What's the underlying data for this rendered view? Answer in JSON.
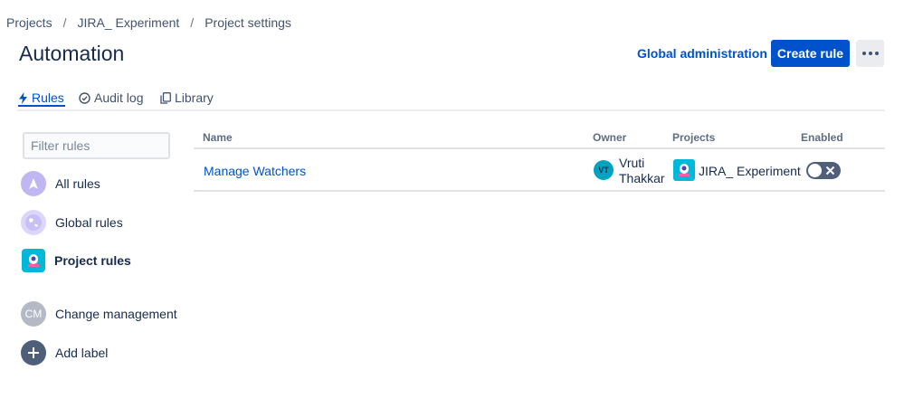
{
  "breadcrumb": {
    "items": [
      "Projects",
      "JIRA_ Experiment",
      "Project settings"
    ],
    "separator": "/"
  },
  "page": {
    "title": "Automation"
  },
  "header": {
    "global_admin_label": "Global administration",
    "create_rule_label": "Create rule"
  },
  "tabs": [
    {
      "label": "Rules",
      "icon": "lightning-icon",
      "active": true
    },
    {
      "label": "Audit log",
      "icon": "check-circle-icon",
      "active": false
    },
    {
      "label": "Library",
      "icon": "copy-icon",
      "active": false
    }
  ],
  "sidebar": {
    "filter_placeholder": "Filter rules",
    "items": [
      {
        "label": "All rules",
        "icon": "all-rules-icon"
      },
      {
        "label": "Global rules",
        "icon": "globe-icon"
      },
      {
        "label": "Project rules",
        "icon": "project-icon"
      },
      {
        "label": "Change management",
        "icon": "label-avatar",
        "initials": "CM"
      },
      {
        "label": "Add label",
        "icon": "add-icon"
      }
    ]
  },
  "table": {
    "headers": {
      "name": "Name",
      "owner": "Owner",
      "projects": "Projects",
      "enabled": "Enabled"
    },
    "rows": [
      {
        "name": "Manage Watchers",
        "owner_initials": "VT",
        "owner_name": "Vruti Thakkar",
        "project": "JIRA_ Experiment",
        "enabled": false
      }
    ]
  },
  "colors": {
    "brand_blue": "#0052cc",
    "toggle_off": "#505f79",
    "avatar_teal": "#00a3bf"
  }
}
